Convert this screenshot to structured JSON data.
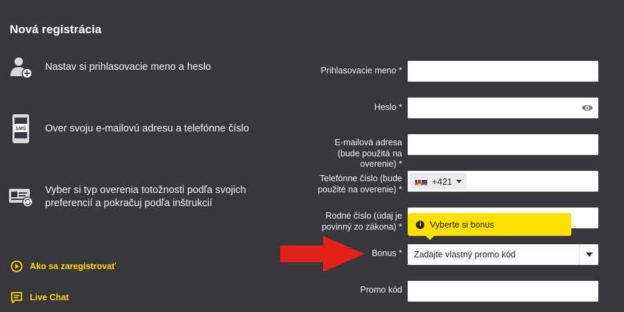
{
  "title": "Nová registrácia",
  "steps": [
    {
      "icon": "user-add-icon",
      "text": "Nastav si prihlasovacie meno a heslo"
    },
    {
      "icon": "sms-phone-icon",
      "text": "Over svoju e-mailovú adresu a telefónne číslo"
    },
    {
      "icon": "id-card-icon",
      "line1": "Vyber si typ overenia totožnosti podľa svojich",
      "line2": "preferencií a pokračuj podľa inštrukcií"
    }
  ],
  "links": {
    "how_to": "Ako sa zaregistrovať",
    "live_chat": "Live Chat"
  },
  "form": {
    "username_label": "Prihlasovacie meno *",
    "password_label": "Heslo *",
    "email_label_1": "E-mailová adresa",
    "email_label_2": "(bude použitá na",
    "email_label_3": "overenie) *",
    "phone_label_1": "Telefónne číslo (bude",
    "phone_label_2": "použité na overenie) *",
    "phone_prefix": "+421",
    "birth_label_1": "Rodné číslo (údaj je",
    "birth_label_2": "povinný zo zákona) *",
    "bonus_label": "Bonus *",
    "bonus_value": "Zadajte vlastný promo kód",
    "promo_label": "Promo kód"
  },
  "tooltip": {
    "text": "Vyberte si bonus"
  },
  "colors": {
    "background": "#38373b",
    "accent": "#ffd800",
    "arrow": "#e32119"
  }
}
